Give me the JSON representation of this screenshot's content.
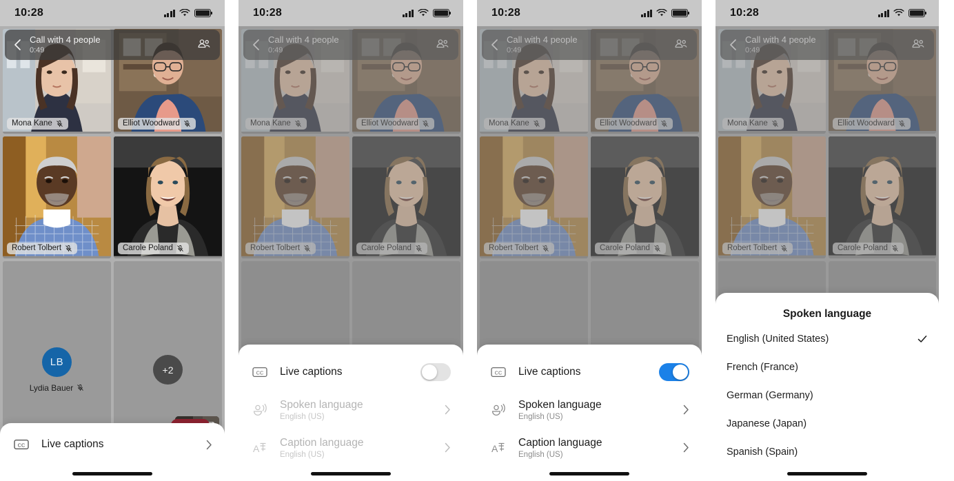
{
  "status_bar": {
    "time": "10:28",
    "icons": [
      "cellular-signal-icon",
      "wifi-icon",
      "battery-icon"
    ]
  },
  "call_header": {
    "back_icon": "chevron-left-icon",
    "title": "Call with 4 people",
    "duration": "0:49",
    "people_icon": "people-icon"
  },
  "participants": [
    {
      "name": "Mona Kane",
      "muted": true,
      "kind": "video"
    },
    {
      "name": "Elliot Woodward",
      "muted": true,
      "kind": "video"
    },
    {
      "name": "Robert Tolbert",
      "muted": true,
      "kind": "video"
    },
    {
      "name": "Carole Poland",
      "muted": true,
      "kind": "video"
    },
    {
      "name": "Lydia Bauer",
      "muted": true,
      "kind": "avatar",
      "initials": "LB"
    },
    {
      "name": "",
      "muted": false,
      "kind": "overflow",
      "overflow_label": "+2"
    }
  ],
  "self_view": {
    "icon": "flip-camera-icon"
  },
  "panels": [
    {
      "id": "panel-collapsed-sheet",
      "sheet": {
        "type": "collapsed",
        "row": {
          "icon": "closed-caption-icon",
          "label": "Live captions",
          "chevron": "chevron-right-icon"
        }
      }
    },
    {
      "id": "panel-captions-off",
      "sheet": {
        "type": "captions-settings",
        "live_captions": {
          "icon": "closed-caption-icon",
          "label": "Live captions",
          "toggle_on": false
        },
        "rows": [
          {
            "icon": "spoken-language-icon",
            "label": "Spoken language",
            "value": "English (US)",
            "chevron": "chevron-right-icon",
            "disabled": true
          },
          {
            "icon": "caption-language-icon",
            "label": "Caption language",
            "value": "English (US)",
            "chevron": "chevron-right-icon",
            "disabled": true
          }
        ]
      }
    },
    {
      "id": "panel-captions-on",
      "sheet": {
        "type": "captions-settings",
        "live_captions": {
          "icon": "closed-caption-icon",
          "label": "Live captions",
          "toggle_on": true
        },
        "rows": [
          {
            "icon": "spoken-language-icon",
            "label": "Spoken language",
            "value": "English (US)",
            "chevron": "chevron-right-icon",
            "disabled": false
          },
          {
            "icon": "caption-language-icon",
            "label": "Caption language",
            "value": "English (US)",
            "chevron": "chevron-right-icon",
            "disabled": false
          }
        ]
      }
    },
    {
      "id": "panel-language-picker",
      "sheet": {
        "type": "language-picker",
        "title": "Spoken language",
        "options": [
          {
            "label": "English (United States)",
            "selected": true
          },
          {
            "label": "French (France)",
            "selected": false
          },
          {
            "label": "German (Germany)",
            "selected": false
          },
          {
            "label": "Japanese (Japan)",
            "selected": false
          },
          {
            "label": "Spanish (Spain)",
            "selected": false
          }
        ],
        "check_icon": "check-icon"
      }
    }
  ],
  "colors": {
    "toggle_on": "#1b81e8",
    "toggle_off": "#e3e3e3",
    "avatar": "#1565a8",
    "end_call": "#8e2230",
    "sheet_bg": "#ffffff",
    "call_bar": "rgba(60,60,60,.72)"
  }
}
